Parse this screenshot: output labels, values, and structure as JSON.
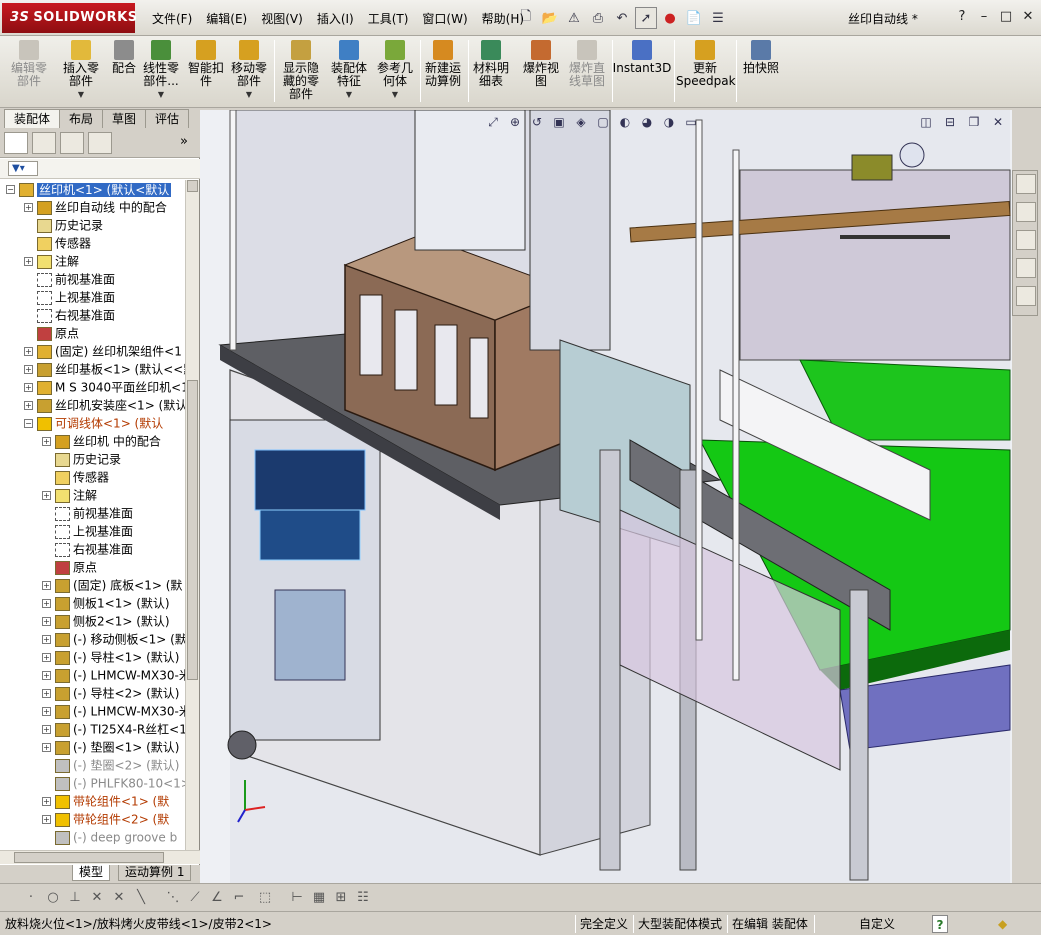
{
  "app": {
    "logo": "SOLIDWORKS",
    "logo_prefix": "3S",
    "document_title": "丝印自动线 *"
  },
  "menu": [
    "文件(F)",
    "编辑(E)",
    "视图(V)",
    "插入(I)",
    "工具(T)",
    "窗口(W)",
    "帮助(H)"
  ],
  "window_controls": {
    "help": "?",
    "minimize": "–",
    "restore": "□",
    "close": "✕"
  },
  "commands": [
    {
      "label": "编辑零\n部件",
      "disabled": true,
      "dropdown": false,
      "color": "#c8c4bb"
    },
    {
      "label": "插入零\n部件",
      "disabled": false,
      "dropdown": true,
      "color": "#e2b93b"
    },
    {
      "label": "配合",
      "disabled": false,
      "dropdown": false,
      "color": "#8c8c8c"
    },
    {
      "label": "线性零\n部件...",
      "disabled": false,
      "dropdown": true,
      "color": "#4a8f3b"
    },
    {
      "label": "智能扣\n件",
      "disabled": false,
      "dropdown": false,
      "color": "#d6a020"
    },
    {
      "label": "移动零\n部件",
      "disabled": false,
      "dropdown": true,
      "color": "#d6a020"
    },
    {
      "label": "显示隐\n藏的零\n部件",
      "disabled": false,
      "dropdown": false,
      "color": "#c4a040"
    },
    {
      "label": "装配体\n特征",
      "disabled": false,
      "dropdown": true,
      "color": "#3f7fc4"
    },
    {
      "label": "参考几\n何体",
      "disabled": false,
      "dropdown": true,
      "color": "#7aa83a"
    },
    {
      "label": "新建运\n动算例",
      "disabled": false,
      "dropdown": false,
      "color": "#d68a20"
    },
    {
      "label": "材料明\n细表",
      "disabled": false,
      "dropdown": false,
      "color": "#3a8a5a"
    },
    {
      "label": "爆炸视\n图",
      "disabled": false,
      "dropdown": false,
      "color": "#c46a30"
    },
    {
      "label": "爆炸直\n线草图",
      "disabled": true,
      "dropdown": false,
      "color": "#c8c4bb"
    },
    {
      "label": "Instant3D",
      "disabled": false,
      "dropdown": false,
      "color": "#4a70c4"
    },
    {
      "label": "更新\nSpeedpak",
      "disabled": false,
      "dropdown": false,
      "color": "#d6a020"
    },
    {
      "label": "拍快照",
      "disabled": false,
      "dropdown": false,
      "color": "#5a7aa8"
    }
  ],
  "cmd_tabs": [
    "装配体",
    "布局",
    "草图",
    "评估"
  ],
  "tree": [
    {
      "label": "丝印机<1> (默认<默认",
      "level": 0,
      "expand": "−",
      "icon": "assembly",
      "selected": true
    },
    {
      "label": "丝印自动线 中的配合",
      "level": 1,
      "expand": "+",
      "icon": "mates"
    },
    {
      "label": "历史记录",
      "level": 1,
      "expand": "",
      "icon": "history"
    },
    {
      "label": "传感器",
      "level": 1,
      "expand": "",
      "icon": "sensor"
    },
    {
      "label": "注解",
      "level": 1,
      "expand": "+",
      "icon": "annotation"
    },
    {
      "label": "前视基准面",
      "level": 1,
      "expand": "",
      "icon": "plane"
    },
    {
      "label": "上视基准面",
      "level": 1,
      "expand": "",
      "icon": "plane"
    },
    {
      "label": "右视基准面",
      "level": 1,
      "expand": "",
      "icon": "plane"
    },
    {
      "label": "原点",
      "level": 1,
      "expand": "",
      "icon": "origin"
    },
    {
      "label": "(固定) 丝印机架组件<1",
      "level": 1,
      "expand": "+",
      "icon": "assembly"
    },
    {
      "label": "丝印基板<1> (默认<<默",
      "level": 1,
      "expand": "+",
      "icon": "part"
    },
    {
      "label": "M S 3040平面丝印机<1",
      "level": 1,
      "expand": "+",
      "icon": "assembly"
    },
    {
      "label": "丝印机安装座<1> (默认",
      "level": 1,
      "expand": "+",
      "icon": "part"
    },
    {
      "label": "可调线体<1> (默认",
      "level": 1,
      "expand": "−",
      "icon": "warn",
      "warn": true
    },
    {
      "label": "丝印机 中的配合",
      "level": 2,
      "expand": "+",
      "icon": "mates"
    },
    {
      "label": "历史记录",
      "level": 2,
      "expand": "",
      "icon": "history"
    },
    {
      "label": "传感器",
      "level": 2,
      "expand": "",
      "icon": "sensor"
    },
    {
      "label": "注解",
      "level": 2,
      "expand": "+",
      "icon": "annotation"
    },
    {
      "label": "前视基准面",
      "level": 2,
      "expand": "",
      "icon": "plane"
    },
    {
      "label": "上视基准面",
      "level": 2,
      "expand": "",
      "icon": "plane"
    },
    {
      "label": "右视基准面",
      "level": 2,
      "expand": "",
      "icon": "plane"
    },
    {
      "label": "原点",
      "level": 2,
      "expand": "",
      "icon": "origin"
    },
    {
      "label": "(固定) 底板<1> (默",
      "level": 2,
      "expand": "+",
      "icon": "part"
    },
    {
      "label": "侧板1<1> (默认)",
      "level": 2,
      "expand": "+",
      "icon": "part"
    },
    {
      "label": "侧板2<1> (默认)",
      "level": 2,
      "expand": "+",
      "icon": "part"
    },
    {
      "label": "(-) 移动侧板<1> (默",
      "level": 2,
      "expand": "+",
      "icon": "part"
    },
    {
      "label": "(-) 导柱<1> (默认)",
      "level": 2,
      "expand": "+",
      "icon": "part"
    },
    {
      "label": "(-) LHMCW-MX30-米",
      "level": 2,
      "expand": "+",
      "icon": "part"
    },
    {
      "label": "(-) 导柱<2> (默认)",
      "level": 2,
      "expand": "+",
      "icon": "part"
    },
    {
      "label": "(-) LHMCW-MX30-米",
      "level": 2,
      "expand": "+",
      "icon": "part"
    },
    {
      "label": "(-) TI25X4-R丝杠<1",
      "level": 2,
      "expand": "+",
      "icon": "part"
    },
    {
      "label": "(-) 垫圈<1> (默认)",
      "level": 2,
      "expand": "+",
      "icon": "part"
    },
    {
      "label": "(-) 垫圈<2> (默认)",
      "level": 2,
      "expand": "",
      "icon": "part-gray",
      "gray": true
    },
    {
      "label": "(-) PHLFK80-10<1>",
      "level": 2,
      "expand": "",
      "icon": "part-gray",
      "gray": true
    },
    {
      "label": "带轮组件<1> (默",
      "level": 2,
      "expand": "+",
      "icon": "warn",
      "warn": true
    },
    {
      "label": "带轮组件<2> (默",
      "level": 2,
      "expand": "+",
      "icon": "warn",
      "warn": true
    },
    {
      "label": "(-) deep groove b",
      "level": 2,
      "expand": "",
      "icon": "part-gray",
      "gray": true
    }
  ],
  "left_tabs": [
    "模型",
    "运动算例 1"
  ],
  "status": {
    "path": "放料烧火位<1>/放料烤火皮带线<1>/皮带2<1>",
    "defined": "完全定义",
    "mode": "大型装配体模式",
    "editing": "在编辑 装配体",
    "custom": "自定义",
    "help": "?"
  }
}
